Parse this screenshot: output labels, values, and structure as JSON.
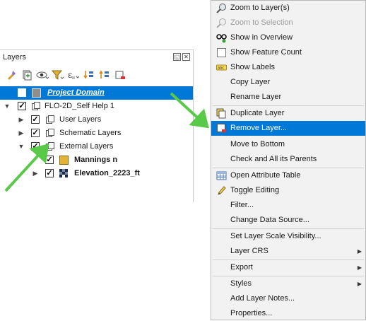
{
  "layers_panel": {
    "title": "Layers",
    "float_icon": "float-icon",
    "close_icon": "close-icon",
    "toolbar": [
      "style-brush-icon",
      "add-group-icon",
      "eye-icon",
      "filter-icon",
      "filter-expression-icon",
      "expand-all-icon",
      "collapse-all-icon",
      "remove-layer-icon"
    ],
    "tree": [
      {
        "label": "Project Domain",
        "checked": false,
        "selected": true
      },
      {
        "label": "FLO-2D_Self Help 1",
        "checked": true
      },
      {
        "label": "User Layers",
        "checked": true
      },
      {
        "label": "Schematic Layers",
        "checked": true
      },
      {
        "label": "External Layers",
        "checked": true
      },
      {
        "label": "Mannings n",
        "checked": true,
        "swatch": "#e3b237"
      },
      {
        "label": "Elevation_2223_ft",
        "checked": true
      }
    ]
  },
  "context_menu": {
    "items": [
      {
        "label": "Zoom to Layer(s)",
        "icon": "zoom-layer-icon"
      },
      {
        "label": "Zoom to Selection",
        "icon": "zoom-selection-icon",
        "disabled": true
      },
      {
        "label": "Show in Overview",
        "icon": "overview-icon"
      },
      {
        "label": "Show Feature Count",
        "icon": "checkbox-icon"
      },
      {
        "label": "Show Labels",
        "icon": "labels-icon"
      },
      {
        "label": "Copy Layer"
      },
      {
        "label": "Rename Layer"
      },
      {
        "label": "Duplicate Layer",
        "icon": "duplicate-icon"
      },
      {
        "label": "Remove Layer...",
        "icon": "remove-layer-icon",
        "active": true
      },
      {
        "label": "Move to Bottom"
      },
      {
        "label": "Check and All its Parents"
      },
      {
        "label": "Open Attribute Table",
        "icon": "table-icon"
      },
      {
        "label": "Toggle Editing",
        "icon": "pencil-icon"
      },
      {
        "label": "Filter..."
      },
      {
        "label": "Change Data Source..."
      },
      {
        "label": "Set Layer Scale Visibility..."
      },
      {
        "label": "Layer CRS",
        "submenu": true
      },
      {
        "label": "Export",
        "submenu": true
      },
      {
        "label": "Styles",
        "submenu": true
      },
      {
        "label": "Add Layer Notes..."
      },
      {
        "label": "Properties..."
      }
    ]
  },
  "colors": {
    "selection": "#0078d7",
    "annotation_arrow": "#59c94a",
    "swatch_mannings": "#e3b237"
  }
}
